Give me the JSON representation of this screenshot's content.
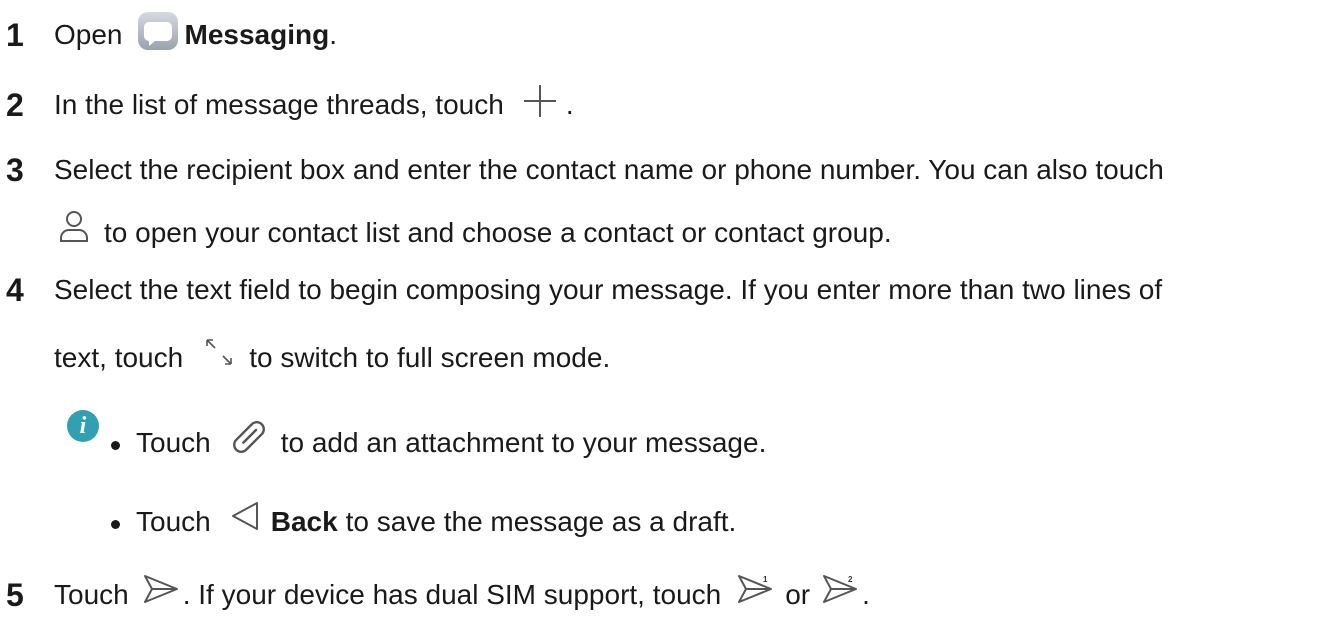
{
  "steps": [
    {
      "num": "1",
      "pre": "Open",
      "app_name": "Messaging",
      "post": "."
    },
    {
      "num": "2",
      "text": "In the list of message threads, touch",
      "post": "."
    },
    {
      "num": "3",
      "line1": "Select the recipient box and enter the contact name or phone number. You can also touch",
      "line2": "to open your contact list and choose a contact or contact group."
    },
    {
      "num": "4",
      "line1": "Select the text field to begin composing your message. If you enter more than two lines of",
      "line2_pre": "text, touch",
      "line2_post": "to switch to full screen mode."
    },
    {
      "num": "5",
      "pre": "Touch",
      "mid": ". If your device has dual SIM support, touch",
      "or": "or",
      "post": "."
    }
  ],
  "notes": {
    "info_icon_glyph": "i",
    "items": [
      {
        "pre": "Touch",
        "post": "to add an attachment to your message."
      },
      {
        "pre": "Touch",
        "bold": "Back",
        "post": "to save the message as a draft."
      }
    ]
  },
  "icons": [
    "messaging-app-icon",
    "plus-icon",
    "contact-icon",
    "expand-icon",
    "attachment-icon",
    "back-icon",
    "send-icon",
    "send-sim1-icon",
    "send-sim2-icon"
  ],
  "colors": {
    "text": "#1a1a1a",
    "info_badge": "#32a0b3",
    "icon_stroke": "#555555"
  }
}
